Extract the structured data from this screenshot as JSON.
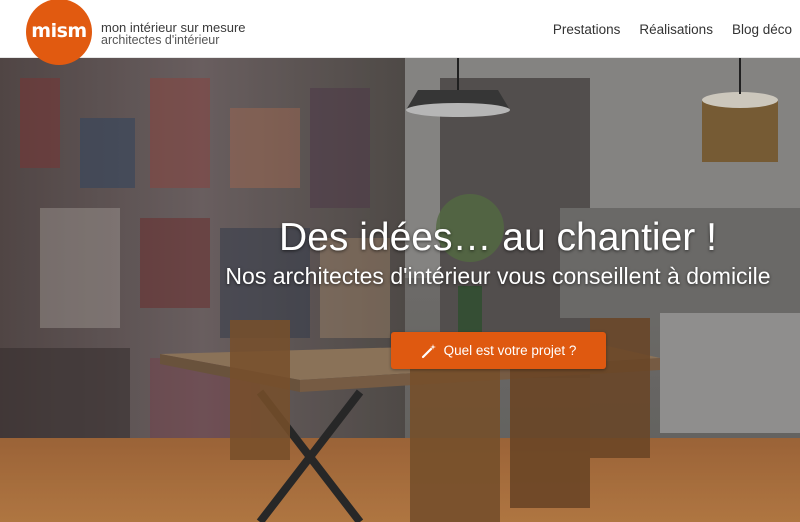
{
  "brand": {
    "logo_text": "mism",
    "tagline_line1": "mon intérieur sur mesure",
    "tagline_line2": "architectes d'intérieur",
    "color": "#e15a10"
  },
  "nav": {
    "items": [
      {
        "label": "Prestations"
      },
      {
        "label": "Réalisations"
      },
      {
        "label": "Blog déco"
      }
    ]
  },
  "hero": {
    "title": "Des idées… au chantier !",
    "subtitle": "Nos architectes d'intérieur vous conseillent à domicile",
    "cta_label": "Quel est votre projet ?",
    "cta_icon": "magic-wand-icon",
    "cta_color": "#df5910"
  }
}
